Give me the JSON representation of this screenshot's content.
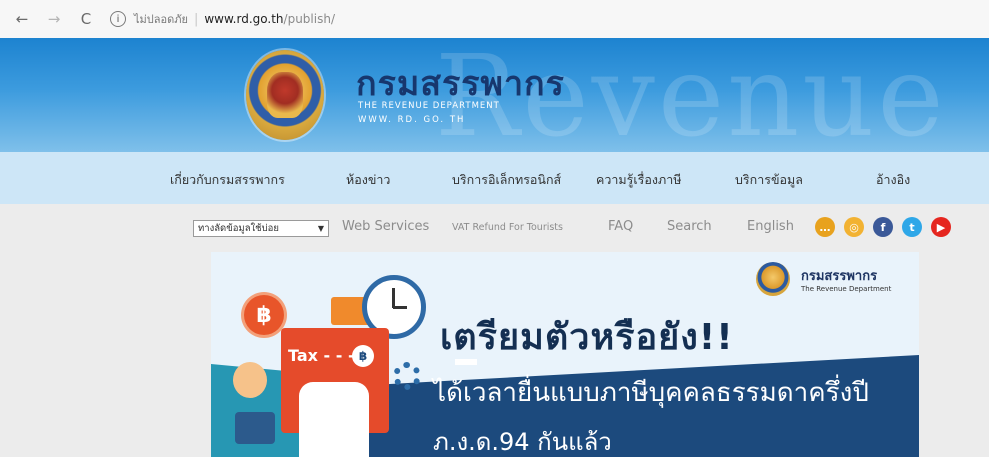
{
  "browser": {
    "back_icon": "back-arrow-icon",
    "forward_icon": "forward-arrow-icon",
    "reload_icon": "reload-icon",
    "security_label": "ไม่ปลอดภัย",
    "url_host": "www.rd.go.th",
    "url_path": "/publish/"
  },
  "header": {
    "background_word": "Revenue",
    "title_th": "กรมสรรพากร",
    "title_en": "THE REVENUE DEPARTMENT",
    "title_www": "WWW. RD. GO. TH"
  },
  "mainnav": {
    "items": [
      {
        "label": "เกี่ยวกับกรมสรรพากร"
      },
      {
        "label": "ห้องข่าว"
      },
      {
        "label": "บริการอิเล็กทรอนิกส์"
      },
      {
        "label": "ความรู้เรื่องภาษี"
      },
      {
        "label": "บริการข้อมูล"
      },
      {
        "label": "อ้างอิง"
      }
    ]
  },
  "toolbar": {
    "select_value": "ทางลัดข้อมูลใช้บ่อย",
    "links": [
      "Web Services",
      "VAT Refund For Tourists",
      "FAQ",
      "Search",
      "English"
    ],
    "social": [
      {
        "name": "chat-icon",
        "glyph": "…",
        "color": "#e8a21e"
      },
      {
        "name": "rss-icon",
        "glyph": "◎",
        "color": "#f2b232"
      },
      {
        "name": "facebook-icon",
        "glyph": "f",
        "color": "#3b5998"
      },
      {
        "name": "twitter-icon",
        "glyph": "t",
        "color": "#2ea7e8"
      },
      {
        "name": "youtube-icon",
        "glyph": "▶",
        "color": "#e5261f"
      }
    ]
  },
  "banner": {
    "brand_th": "กรมสรรพากร",
    "brand_en": "The Revenue Department",
    "headline": "เตรียมตัวหรือยัง!!",
    "sub1": "ได้เวลายื่นแบบภาษีบุคคลธรรมดาครึ่งปี",
    "sub2": "ภ.ง.ด.94 กันแล้ว",
    "tax_label": "Tax - - -",
    "coin_symbol": "฿"
  },
  "colors": {
    "header_blue": "#1d83d0",
    "nav_bg": "#cde6f7",
    "banner_navy": "#1c4a7d",
    "title_navy": "#17376e"
  }
}
